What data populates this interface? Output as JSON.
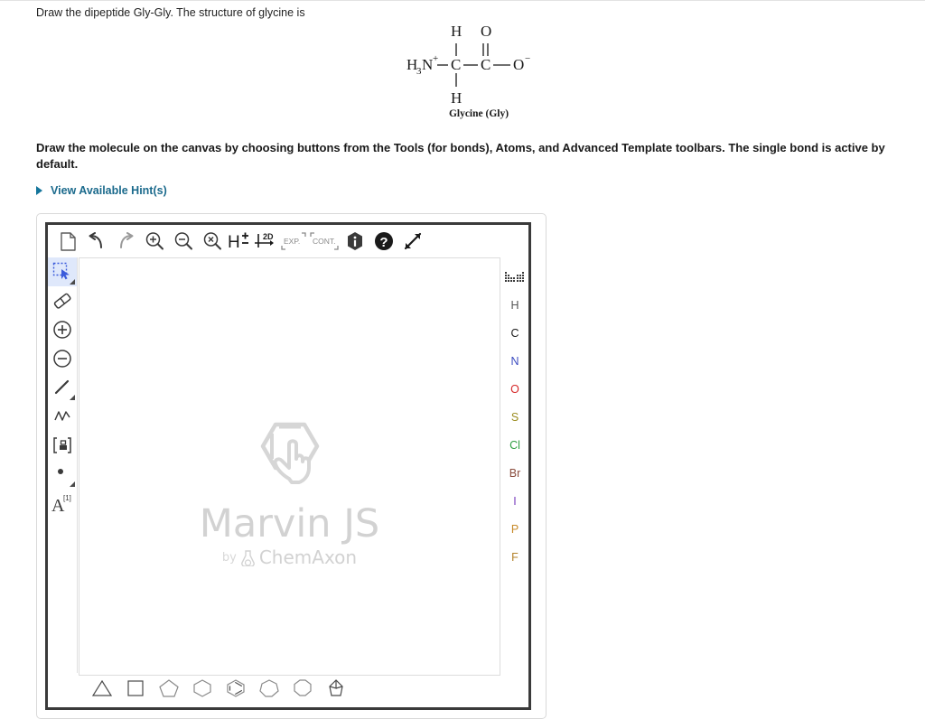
{
  "question": {
    "prompt": "Draw the dipeptide Gly-Gly. The structure of glycine is",
    "instruction": "Draw the molecule on the canvas by choosing buttons from the Tools (for bonds), Atoms, and Advanced Template toolbars. The single bond is active by default.",
    "hint_link": "View Available Hint(s)"
  },
  "structure": {
    "caption": "Glycine (Gly)",
    "labels": {
      "amine": "H",
      "amine_sub": "3",
      "amine_n": "N",
      "amine_charge": "+",
      "top_h": "H",
      "bottom_h": "H",
      "alpha_carbon": "C",
      "carboxyl_carbon": "C",
      "carbonyl_o": "O",
      "oxyanion_o": "O",
      "oxyanion_charge": "-"
    }
  },
  "editor": {
    "top_toolbar": [
      {
        "name": "new-file-icon",
        "label": "New"
      },
      {
        "name": "undo-icon",
        "label": "Undo"
      },
      {
        "name": "redo-icon",
        "label": "Redo"
      },
      {
        "name": "zoom-in-icon",
        "label": "Zoom In"
      },
      {
        "name": "zoom-out-icon",
        "label": "Zoom Out"
      },
      {
        "name": "zoom-reset-icon",
        "label": "Reset Zoom"
      },
      {
        "name": "hydrogen-toggle-icon",
        "label": "H"
      },
      {
        "name": "clean-2d-icon",
        "label": "2D"
      },
      {
        "name": "expand-icon",
        "label": "EXP."
      },
      {
        "name": "contract-icon",
        "label": "CONT."
      },
      {
        "name": "info-icon",
        "label": "Info"
      },
      {
        "name": "help-icon",
        "label": "Help"
      },
      {
        "name": "fullscreen-icon",
        "label": "Fullscreen"
      }
    ],
    "left_toolbar": [
      {
        "name": "selection-tool",
        "label": "Selection",
        "active": true,
        "has_dropdown": true
      },
      {
        "name": "eraser-tool",
        "label": "Eraser",
        "active": false,
        "has_dropdown": false
      },
      {
        "name": "increase-charge-tool",
        "label": "Increase Charge",
        "active": false,
        "has_dropdown": false
      },
      {
        "name": "decrease-charge-tool",
        "label": "Decrease Charge",
        "active": false,
        "has_dropdown": false
      },
      {
        "name": "single-bond-tool",
        "label": "Single Bond",
        "active": false,
        "has_dropdown": true
      },
      {
        "name": "chain-tool",
        "label": "Chain",
        "active": false,
        "has_dropdown": false
      },
      {
        "name": "bracket-tool",
        "label": "Bracket",
        "active": false,
        "has_dropdown": false
      },
      {
        "name": "radical-tool",
        "label": "Radical",
        "active": false,
        "has_dropdown": true
      },
      {
        "name": "atom-label-tool",
        "label": "A",
        "superscript": "[1]",
        "active": false,
        "has_dropdown": false
      }
    ],
    "atom_palette": [
      {
        "name": "periodic-table-icon",
        "symbol": "",
        "color": "#333333"
      },
      {
        "name": "atom-h",
        "symbol": "H",
        "color": "#555555"
      },
      {
        "name": "atom-c",
        "symbol": "C",
        "color": "#1a1a1a"
      },
      {
        "name": "atom-n",
        "symbol": "N",
        "color": "#3b4cc0"
      },
      {
        "name": "atom-o",
        "symbol": "O",
        "color": "#d62728"
      },
      {
        "name": "atom-s",
        "symbol": "S",
        "color": "#9a8b1e"
      },
      {
        "name": "atom-cl",
        "symbol": "Cl",
        "color": "#2e9e41"
      },
      {
        "name": "atom-br",
        "symbol": "Br",
        "color": "#8a4b3c"
      },
      {
        "name": "atom-i",
        "symbol": "I",
        "color": "#7b3fbf"
      },
      {
        "name": "atom-p",
        "symbol": "P",
        "color": "#c78a28"
      },
      {
        "name": "atom-f",
        "symbol": "F",
        "color": "#b3822a"
      }
    ],
    "templates": [
      {
        "name": "template-cyclopropane",
        "label": "Cyclopropane",
        "sides": 3
      },
      {
        "name": "template-cyclobutane",
        "label": "Cyclobutane",
        "sides": 4
      },
      {
        "name": "template-cyclopentane",
        "label": "Cyclopentane",
        "sides": 5
      },
      {
        "name": "template-cyclohexane",
        "label": "Cyclohexane",
        "sides": 6
      },
      {
        "name": "template-benzene",
        "label": "Benzene",
        "sides": 6
      },
      {
        "name": "template-cycloheptane",
        "label": "Cycloheptane",
        "sides": 7
      },
      {
        "name": "template-cyclooctane",
        "label": "Cyclooctane",
        "sides": 8
      },
      {
        "name": "template-norbornane",
        "label": "Norbornane",
        "sides": 0
      }
    ],
    "watermark": {
      "title": "Marvin JS",
      "by": "by",
      "vendor": "ChemAxon"
    }
  },
  "colors": {
    "link": "#1b6a8c",
    "selection_active_bg": "#dfe8fb",
    "editor_border": "#3a3a3a",
    "watermark": "#d2d2d2"
  }
}
